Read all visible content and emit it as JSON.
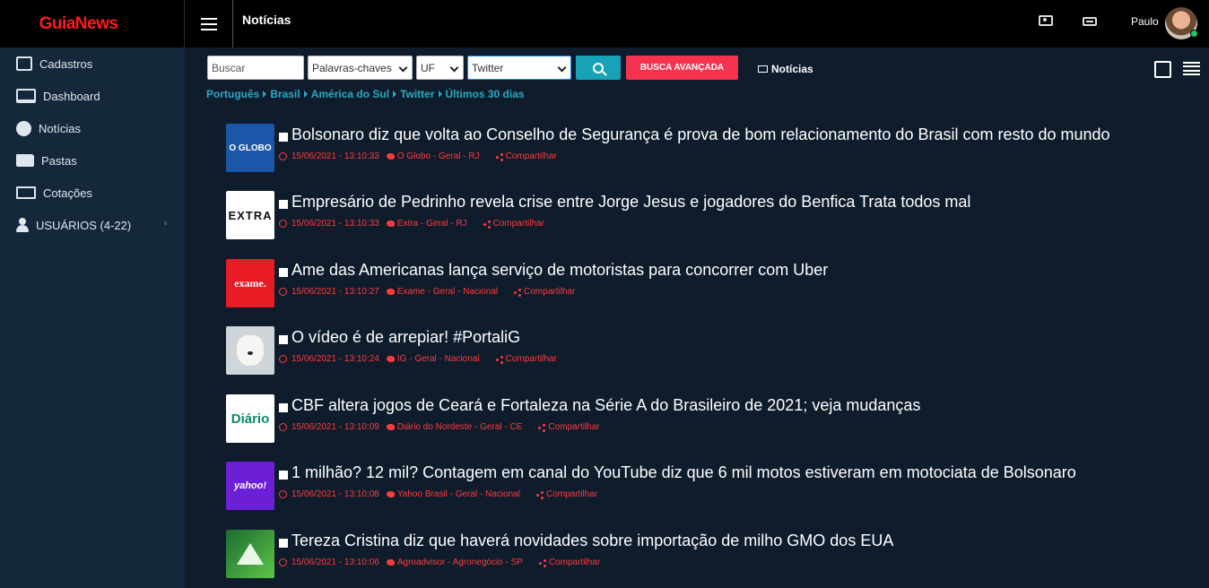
{
  "app": {
    "brand": "GuiaNews",
    "page_title": "Notícias",
    "user_name": "Paulo"
  },
  "sidebar": {
    "items": [
      {
        "label": "Cadastros",
        "icon": "edit-icon"
      },
      {
        "label": "Dashboard",
        "icon": "monitor-icon"
      },
      {
        "label": "Notícias",
        "icon": "globe-icon"
      },
      {
        "label": "Pastas",
        "icon": "folder-open-icon"
      },
      {
        "label": "Cotações",
        "icon": "money-icon"
      },
      {
        "label": "USUÁRIOS (4-22)",
        "icon": "user-icon"
      }
    ]
  },
  "toolbar": {
    "search_placeholder": "Buscar",
    "keywords_select": "Palavras-chaves",
    "uf_select": "UF",
    "source_select": "Twitter",
    "advanced_search_label": "BUSCA AVANÇADA",
    "news_link_label": "Notícias"
  },
  "breadcrumb": [
    "Português",
    "Brasil",
    "América do Sul",
    "Twitter",
    "Últimos 30 dias"
  ],
  "news": [
    {
      "logo": "O GLOBO",
      "title": "Bolsonaro diz que volta ao Conselho de Segurança é prova de bom relacionamento do Brasil com resto do mundo",
      "datetime": "15/06/2021 - 13:10:33",
      "source": "O Globo - Geral - RJ",
      "share": "Compartilhar"
    },
    {
      "logo": "EXTRA",
      "title": "Empresário de Pedrinho revela crise entre Jorge Jesus e jogadores do Benfica Trata todos mal",
      "datetime": "15/06/2021 - 13:10:33",
      "source": "Extra - Geral - RJ",
      "share": "Compartilhar"
    },
    {
      "logo": "exame.",
      "title": "Ame das Americanas lança serviço de motoristas para concorrer com Uber",
      "datetime": "15/06/2021 - 13:10:27",
      "source": "Exame - Geral - Nacional",
      "share": "Compartilhar"
    },
    {
      "logo": "",
      "title": "O vídeo é de arrepiar! #PortaliG",
      "datetime": "15/06/2021 - 13:10:24",
      "source": "IG - Geral - Nacional",
      "share": "Compartilhar"
    },
    {
      "logo": "Diário",
      "title": "CBF altera jogos de Ceará e Fortaleza na Série A do Brasileiro de 2021; veja mudanças",
      "datetime": "15/06/2021 - 13:10:09",
      "source": "Diário do Nordeste - Geral - CE",
      "share": "Compartilhar"
    },
    {
      "logo": "yahoo!",
      "title": "1 milhão? 12 mil? Contagem em canal do YouTube diz que 6 mil motos estiveram em motociata de Bolsonaro",
      "datetime": "15/06/2021 - 13:10:08",
      "source": "Yahoo Brasil - Geral - Nacional",
      "share": "Compartilhar"
    },
    {
      "logo": "",
      "title": "Tereza Cristina diz que haverá novidades sobre importação de milho GMO dos EUA",
      "datetime": "15/06/2021 - 13:10:06",
      "source": "Agroadvisor - Agronegócio - SP",
      "share": "Compartilhar"
    }
  ],
  "colors": {
    "brand": "#ff1a1a",
    "topbar": "#000000",
    "sidebar": "#15273a",
    "content_bg": "#0f1c2c",
    "accent_link": "#2aa8c4",
    "meta_red": "#ff3b3b",
    "search_button": "#17a2b8",
    "advanced_button": "#f5334f",
    "online_status": "#22c55e"
  }
}
